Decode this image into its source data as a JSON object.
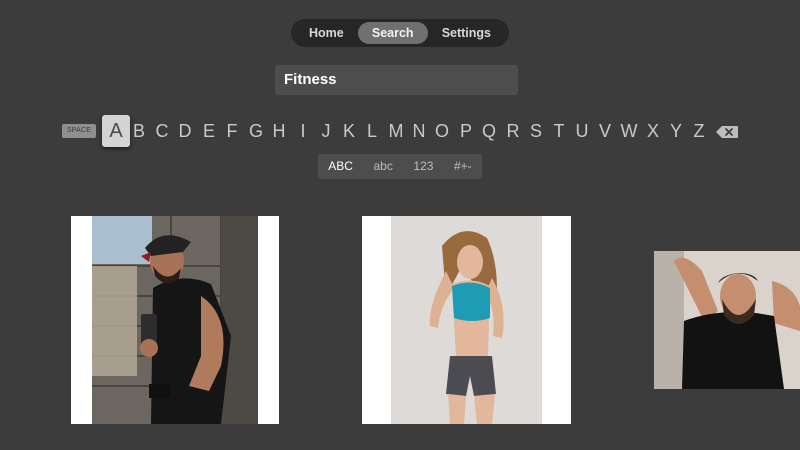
{
  "tabs": [
    {
      "label": "Home",
      "active": false
    },
    {
      "label": "Search",
      "active": true
    },
    {
      "label": "Settings",
      "active": false
    }
  ],
  "search": {
    "value": "Fitness"
  },
  "keyboard": {
    "space_label": "SPACE",
    "focused_key": "A",
    "letters": [
      "B",
      "C",
      "D",
      "E",
      "F",
      "G",
      "H",
      "I",
      "J",
      "K",
      "L",
      "M",
      "N",
      "O",
      "P",
      "Q",
      "R",
      "S",
      "T",
      "U",
      "V",
      "W",
      "X",
      "Y",
      "Z"
    ],
    "backspace_icon": "backspace-icon",
    "modes": [
      {
        "label": "ABC",
        "active": true
      },
      {
        "label": "abc",
        "active": false
      },
      {
        "label": "123",
        "active": false
      },
      {
        "label": "#+-",
        "active": false
      }
    ]
  },
  "results": [
    {
      "name": "result-man-selfie",
      "description_icon": "photo"
    },
    {
      "name": "result-woman-fitness",
      "description_icon": "photo"
    },
    {
      "name": "result-man-bearded",
      "description_icon": "photo"
    }
  ],
  "colors": {
    "background": "#3c3c3c",
    "tabbar": "#262626",
    "active_tab": "#707070",
    "field": "#4d4d4d",
    "focus_key": "#d3d3d3"
  }
}
